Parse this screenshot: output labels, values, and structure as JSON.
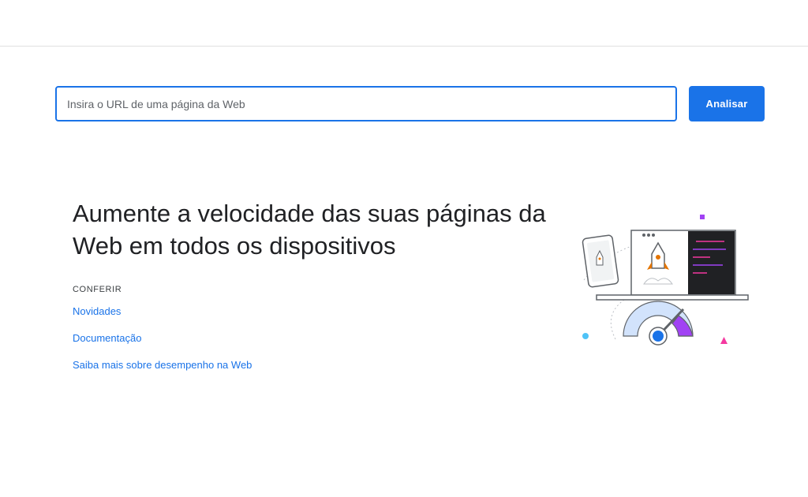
{
  "search": {
    "placeholder": "Insira o URL de uma página da Web",
    "button_label": "Analisar"
  },
  "hero": {
    "headline": "Aumente a velocidade das suas páginas da Web em todos os dispositivos",
    "section_label": "CONFERIR",
    "links": [
      {
        "label": "Novidades"
      },
      {
        "label": "Documentação"
      },
      {
        "label": "Saiba mais sobre desempenho na Web"
      }
    ]
  },
  "illustration": {
    "description_icon": "speed-gauge-devices-illustration",
    "colors": {
      "accent_blue": "#1a73e8",
      "gauge_purple": "#a142f4",
      "light_blue": "#d2e3fc",
      "dark_panel": "#202124",
      "pink": "#f439a0"
    }
  },
  "colors": {
    "primary": "#1a73e8",
    "text": "#202124",
    "border": "#e0e0e0"
  }
}
